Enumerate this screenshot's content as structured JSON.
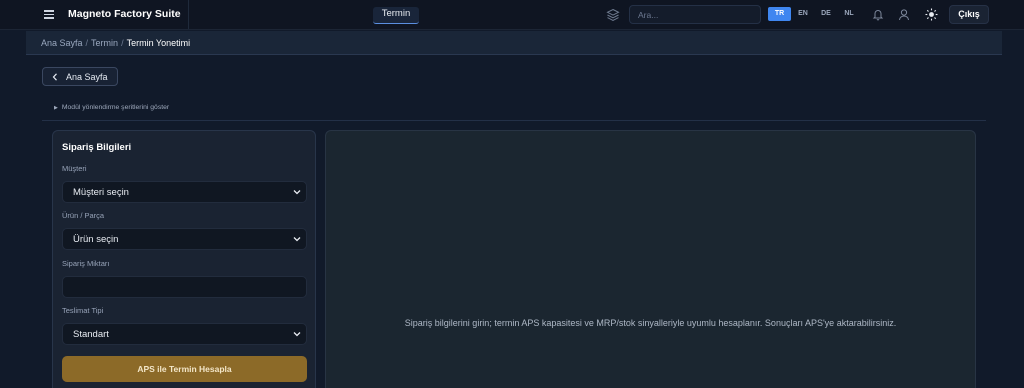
{
  "header": {
    "brand": "Magneto Factory Suite",
    "active_tab": "Termin",
    "search_placeholder": "Ara...",
    "languages": [
      {
        "code": "TR",
        "active": true
      },
      {
        "code": "EN",
        "active": false
      },
      {
        "code": "DE",
        "active": false
      },
      {
        "code": "NL",
        "active": false
      }
    ],
    "logout_label": "Çıkış",
    "icons": [
      "menu-icon",
      "layers-icon",
      "bell-icon",
      "user-icon",
      "sun-icon"
    ]
  },
  "breadcrumb": {
    "home": "Ana Sayfa",
    "section": "Termin",
    "current": "Termin Yonetimi"
  },
  "back_button": "Ana Sayfa",
  "module_toggle": "Modül yönlendirme şeritlerini göster",
  "form": {
    "title": "Sipariş Bilgileri",
    "customer_label": "Müşteri",
    "customer_value": "Müşteri seçin",
    "product_label": "Ürün / Parça",
    "product_value": "Ürün seçin",
    "quantity_label": "Sipariş Miktarı",
    "quantity_value": "",
    "delivery_label": "Teslimat Tipi",
    "delivery_value": "Standart",
    "submit_label": "APS ile Termin Hesapla"
  },
  "result": {
    "empty_message": "Sipariş bilgilerini girin; termin APS kapasitesi ve MRP/stok sinyalleriyle uyumlu hesaplanır. Sonuçları APS'ye aktarabilirsiniz."
  },
  "colors": {
    "accent": "#3f86f0",
    "primary_button": "#8c6a28",
    "background": "#111a2a"
  }
}
